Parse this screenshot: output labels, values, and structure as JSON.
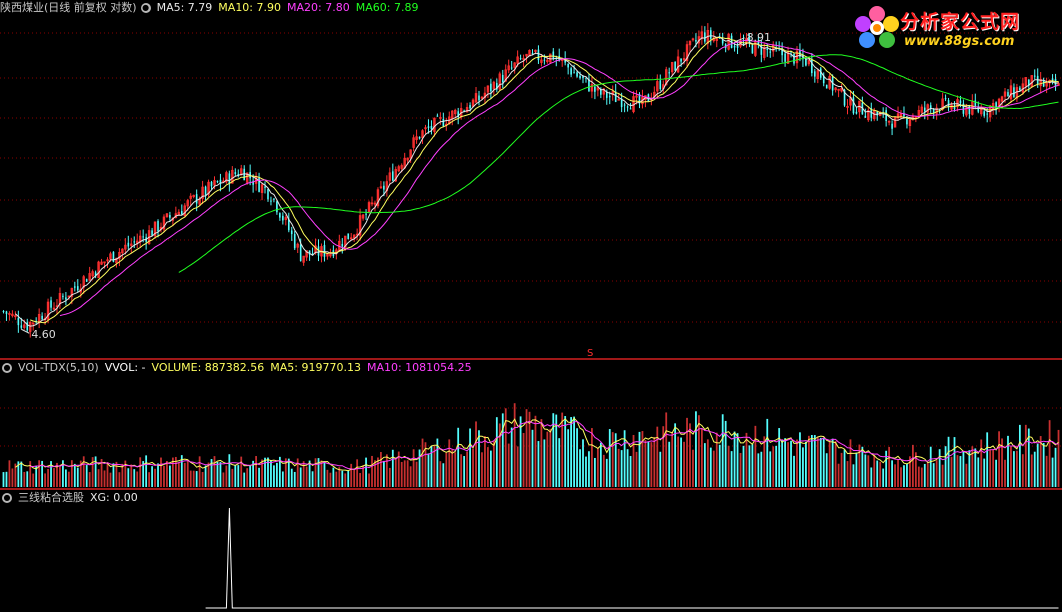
{
  "main_header": {
    "title": "陕西煤业(日线 前复权 对数)",
    "ma5": "MA5: 7.79",
    "ma10": "MA10: 7.90",
    "ma20": "MA20: 7.80",
    "ma60": "MA60: 7.89"
  },
  "vol_header": {
    "name": "VOL-TDX(5,10)",
    "vvol": "VVOL: -",
    "volume": "VOLUME: 887382.56",
    "ma5": "MA5: 919770.13",
    "ma10": "MA10: 1081054.25"
  },
  "ind_header": {
    "name": "三线粘合选股",
    "xg": "XG: 0.00"
  },
  "annotations": {
    "high": "8.91",
    "low": "4.60",
    "marker": "S"
  },
  "logo": {
    "name": "分析家公式网",
    "url": "www.88gs.com"
  },
  "colors": {
    "up": "#ff3030",
    "down": "#54ffff",
    "ma5": "#e8e8e8",
    "ma10": "#ffff60",
    "ma20": "#ff40ff",
    "ma60": "#20ff20",
    "grid": "#8a0000",
    "indicator": "#ffffff"
  },
  "chart_data": [
    {
      "type": "candlestick",
      "scale": "log",
      "y_range": [
        4.35,
        9.3
      ],
      "price_keypoints": [
        [
          0,
          4.75
        ],
        [
          8,
          4.6
        ],
        [
          20,
          4.9
        ],
        [
          35,
          5.35
        ],
        [
          50,
          5.7
        ],
        [
          60,
          6.0
        ],
        [
          70,
          6.3
        ],
        [
          80,
          6.55
        ],
        [
          90,
          6.2
        ],
        [
          100,
          5.4
        ],
        [
          110,
          5.45
        ],
        [
          118,
          5.7
        ],
        [
          125,
          6.1
        ],
        [
          140,
          7.1
        ],
        [
          160,
          7.7
        ],
        [
          175,
          8.45
        ],
        [
          185,
          8.5
        ],
        [
          200,
          7.8
        ],
        [
          215,
          7.6
        ],
        [
          235,
          8.9
        ],
        [
          250,
          8.7
        ],
        [
          270,
          8.4
        ],
        [
          285,
          7.6
        ],
        [
          300,
          7.3
        ],
        [
          315,
          7.6
        ],
        [
          330,
          7.5
        ],
        [
          345,
          8.0
        ],
        [
          355,
          7.9
        ]
      ],
      "bar_count": 356,
      "high_label_bar": 246,
      "low_label_bar": 6,
      "series": [
        "MA5",
        "MA10",
        "MA20",
        "MA60"
      ]
    },
    {
      "type": "bar",
      "name": "VOLUME",
      "y_range": [
        0,
        3000000
      ],
      "level_keypoints": [
        [
          0,
          0.25
        ],
        [
          60,
          0.3
        ],
        [
          120,
          0.25
        ],
        [
          150,
          0.5
        ],
        [
          175,
          0.8
        ],
        [
          185,
          0.7
        ],
        [
          200,
          0.55
        ],
        [
          220,
          0.65
        ],
        [
          245,
          0.7
        ],
        [
          265,
          0.55
        ],
        [
          300,
          0.35
        ],
        [
          330,
          0.5
        ],
        [
          355,
          0.6
        ]
      ],
      "series": [
        "VOLUME",
        "MA5",
        "MA10"
      ]
    },
    {
      "type": "line",
      "name": "XG",
      "y_range": [
        0,
        1
      ],
      "spike_bar": 76,
      "values_note_bar_start": 68
    }
  ]
}
